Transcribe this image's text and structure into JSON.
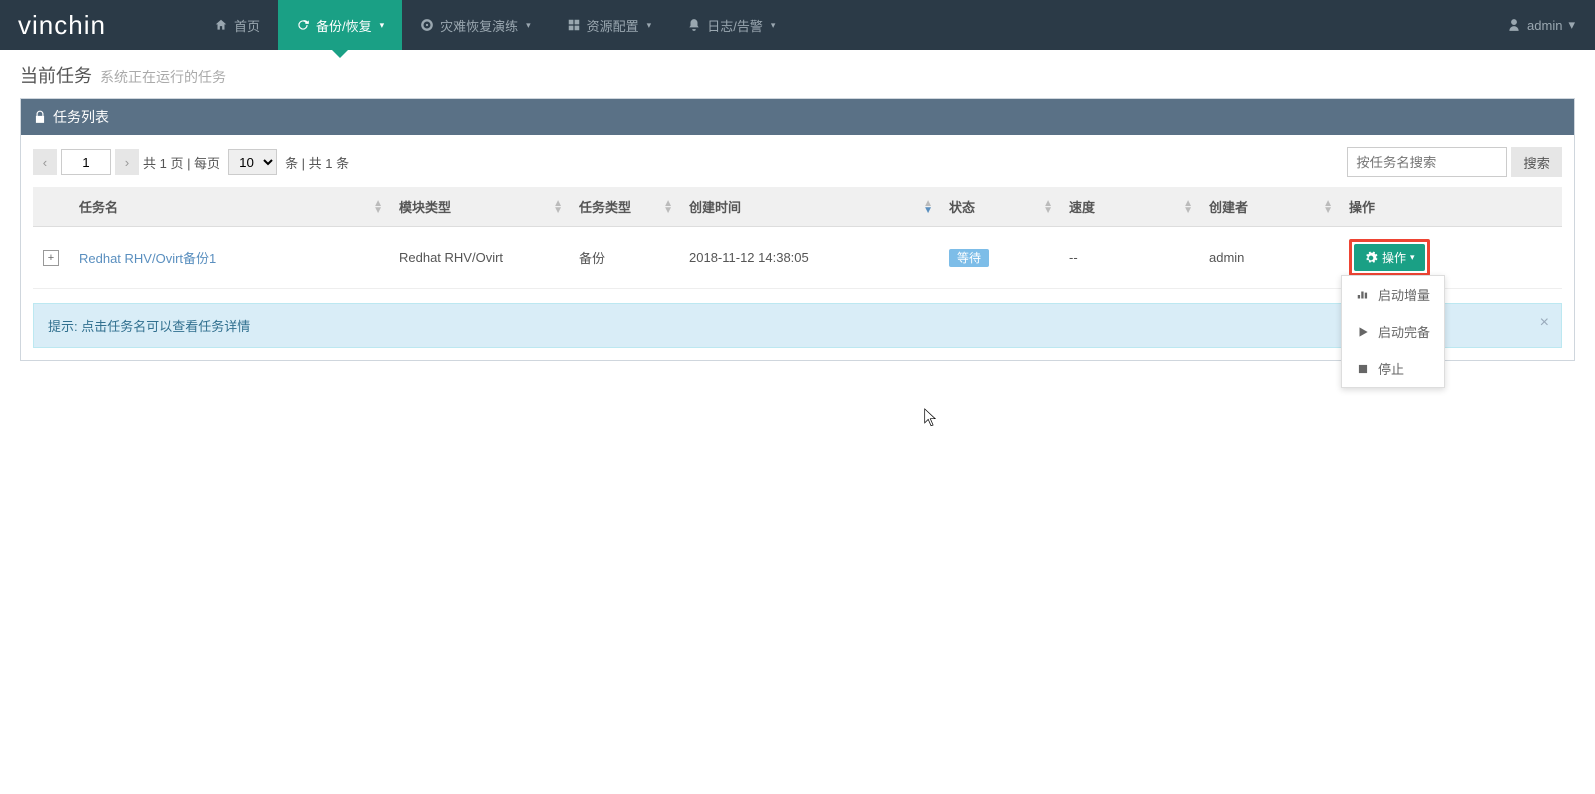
{
  "brand": "vinchin",
  "nav": {
    "home": "首页",
    "backup": "备份/恢复",
    "disaster": "灾难恢复演练",
    "resource": "资源配置",
    "logs": "日志/告警"
  },
  "user": {
    "name": "admin"
  },
  "page": {
    "title": "当前任务",
    "subtitle": "系统正在运行的任务"
  },
  "panel": {
    "title": "任务列表"
  },
  "pagination": {
    "current": "1",
    "total_pages_label": "共 1 页 | 每页",
    "page_size": "10",
    "records_label": "条 | 共 1 条"
  },
  "search": {
    "placeholder": "按任务名搜索",
    "button": "搜索"
  },
  "columns": {
    "task_name": "任务名",
    "module_type": "模块类型",
    "task_type": "任务类型",
    "create_time": "创建时间",
    "status": "状态",
    "speed": "速度",
    "creator": "创建者",
    "action": "操作"
  },
  "rows": [
    {
      "task_name": "Redhat RHV/Ovirt备份1",
      "module_type": "Redhat RHV/Ovirt",
      "task_type": "备份",
      "create_time": "2018-11-12 14:38:05",
      "status": "等待",
      "speed": "--",
      "creator": "admin"
    }
  ],
  "action_label": "操作",
  "dropdown": {
    "start_inc": "启动增量",
    "start_full": "启动完备",
    "stop": "停止"
  },
  "tip": "提示: 点击任务名可以查看任务详情"
}
